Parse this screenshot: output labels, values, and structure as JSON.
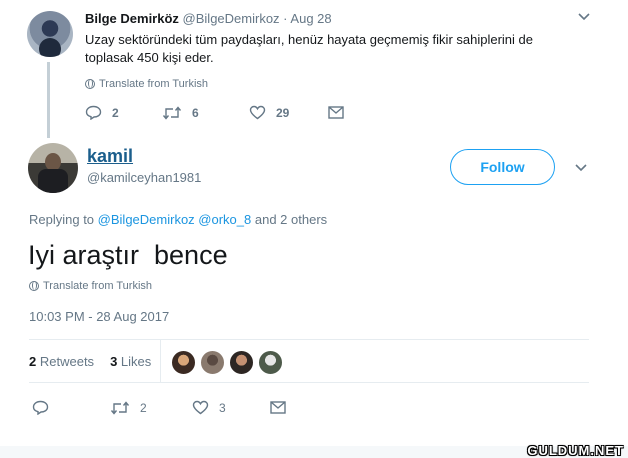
{
  "parent_tweet": {
    "name": "Bilge Demirköz",
    "handle": "@BilgeDemirkoz",
    "dot": "·",
    "date": "Aug 28",
    "text": "Uzay sektöründeki tüm paydaşları, henüz hayata geçmemiş fikir sahiplerini de toplasak 450 kişi eder.",
    "translate": "Translate from Turkish",
    "replies": "2",
    "retweets": "6",
    "likes": "29"
  },
  "main_tweet": {
    "name": "kamil",
    "handle": "@kamilceyhan1981",
    "follow_label": "Follow",
    "replying_prefix": "Replying to",
    "replying_to_1": "@BilgeDemirkoz",
    "replying_to_2": "@orko_8",
    "replying_suffix": "and 2 others",
    "text": "Iyi araştır  bence",
    "translate": "Translate from Turkish",
    "timestamp": "10:03 PM - 28 Aug 2017",
    "retweets_count": "2",
    "retweets_label": "Retweets",
    "likes_count": "3",
    "likes_label": "Likes",
    "action_retweets": "2",
    "action_likes": "3"
  },
  "watermark": "GULDUM.NET",
  "colors": {
    "link": "#1b95e0",
    "follow": "#1da1f2",
    "muted": "#657786"
  }
}
